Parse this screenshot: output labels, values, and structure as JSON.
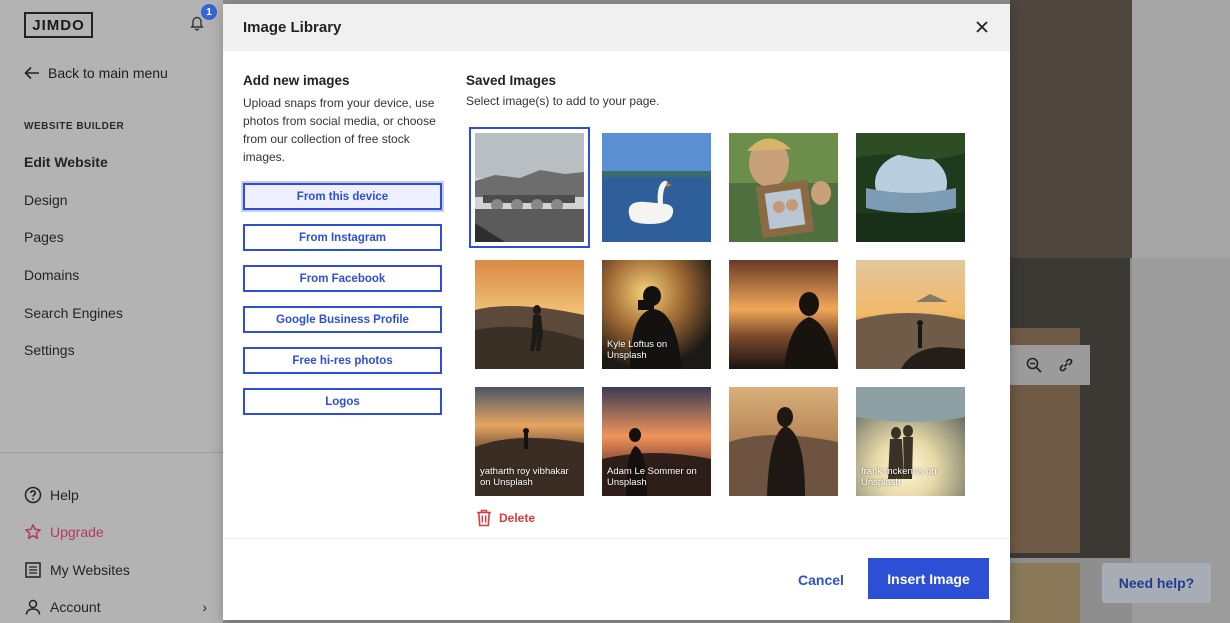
{
  "sidebar": {
    "logo": "JIMDO",
    "notification_count": "1",
    "back_label": "Back to main menu",
    "section_label": "WEBSITE BUILDER",
    "nav": [
      "Edit Website",
      "Design",
      "Pages",
      "Domains",
      "Search Engines",
      "Settings"
    ],
    "bottom": {
      "help": "Help",
      "upgrade": "Upgrade",
      "my_websites": "My Websites",
      "account": "Account"
    }
  },
  "need_help": "Need help?",
  "modal": {
    "title": "Image Library",
    "left": {
      "heading": "Add new images",
      "description": "Upload snaps from your device, use photos from social media, or choose from our collection of free stock images.",
      "buttons": [
        "From this device",
        "From Instagram",
        "From Facebook",
        "Google Business Profile",
        "Free hi-res photos",
        "Logos"
      ]
    },
    "right": {
      "heading": "Saved Images",
      "description": "Select image(s) to add to your page.",
      "images": [
        {
          "subject": "stone-bridge-town",
          "credit": "",
          "selected": true
        },
        {
          "subject": "swan-on-lake",
          "credit": ""
        },
        {
          "subject": "man-holding-photo-frame",
          "credit": ""
        },
        {
          "subject": "forest-lake",
          "credit": ""
        },
        {
          "subject": "runner-sunset-hills",
          "credit": ""
        },
        {
          "subject": "photographer-silhouette",
          "credit": "Kyle Loftus on Unsplash"
        },
        {
          "subject": "man-silhouette-sunset",
          "credit": ""
        },
        {
          "subject": "person-on-rock-mountain",
          "credit": ""
        },
        {
          "subject": "person-silhouette-hills",
          "credit": "yatharth roy vibhakar on Unsplash"
        },
        {
          "subject": "woman-silhouette-sunset",
          "credit": "Adam Le Sommer on Unsplash"
        },
        {
          "subject": "man-silhouette-valley",
          "credit": ""
        },
        {
          "subject": "couple-silhouette-sunlight",
          "credit": "frank mckenna on Unsplash"
        }
      ],
      "delete_label": "Delete"
    },
    "footer": {
      "cancel_label": "Cancel",
      "insert_label": "Insert Image"
    }
  },
  "colors": {
    "accent": "#2c4fd6",
    "danger": "#e03a3a",
    "upgrade": "#b33a68"
  }
}
